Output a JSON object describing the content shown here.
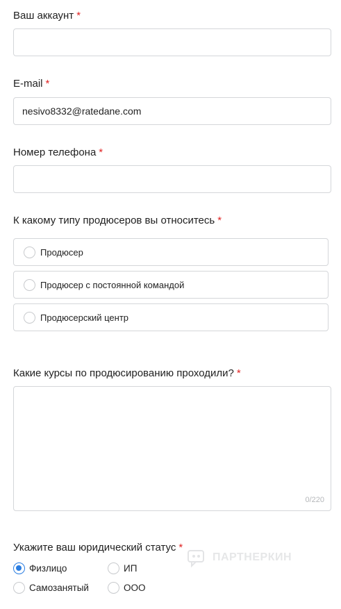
{
  "account": {
    "label": "Ваш аккаунт",
    "required": "*",
    "value": ""
  },
  "email": {
    "label": "E-mail",
    "required": "*",
    "value": "nesivo8332@ratedane.com"
  },
  "phone": {
    "label": "Номер телефона",
    "required": "*",
    "value": ""
  },
  "producer_type": {
    "label": "К какому типу продюсеров вы относитесь",
    "required": "*",
    "options": [
      "Продюсер",
      "Продюсер с постоянной командой",
      "Продюсерский центр"
    ]
  },
  "courses": {
    "label": "Какие курсы по продюсированию проходили?",
    "required": "*",
    "counter": "0/220"
  },
  "legal_status": {
    "label": "Укажите ваш юридический статус",
    "required": "*",
    "options": [
      "Физлицо",
      "ИП",
      "Самозанятый",
      "ООО"
    ],
    "selected": "Физлицо"
  },
  "watermark": {
    "text": "ПАРТНЕРКИН"
  },
  "colors": {
    "accent": "#2a7de1",
    "required": "#e02424",
    "border": "#d4d6d9"
  }
}
